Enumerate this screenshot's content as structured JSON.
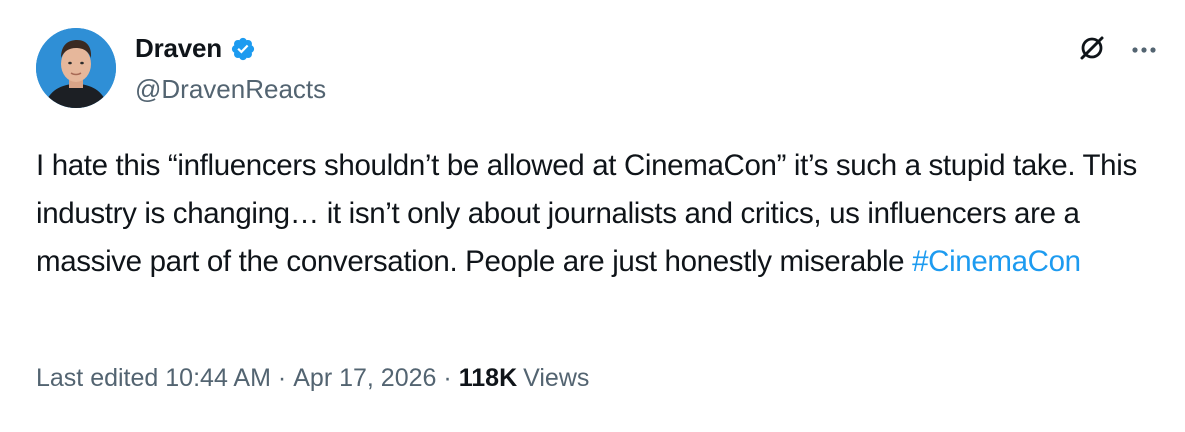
{
  "author": {
    "display_name": "Draven",
    "handle": "@DravenReacts",
    "verified": true,
    "verified_color": "#1d9bf0"
  },
  "post": {
    "text_before_hashtag": "I hate this “influencers shouldn’t be allowed at CinemaCon” it’s such a stupid take. This industry is changing… it isn’t only about journalists and critics, us influencers are a massive part of the conversation. People are just honestly miserable ",
    "hashtag": "#CinemaCon",
    "hashtag_color": "#1d9bf0"
  },
  "meta": {
    "edited_label": "Last edited",
    "time": "10:44 AM",
    "separator": "·",
    "date": "Apr 17, 2026",
    "views_count": "118K",
    "views_label": "Views"
  },
  "icons": {
    "grok": "grok-icon",
    "more": "more-icon",
    "verified": "verified-badge-icon"
  }
}
